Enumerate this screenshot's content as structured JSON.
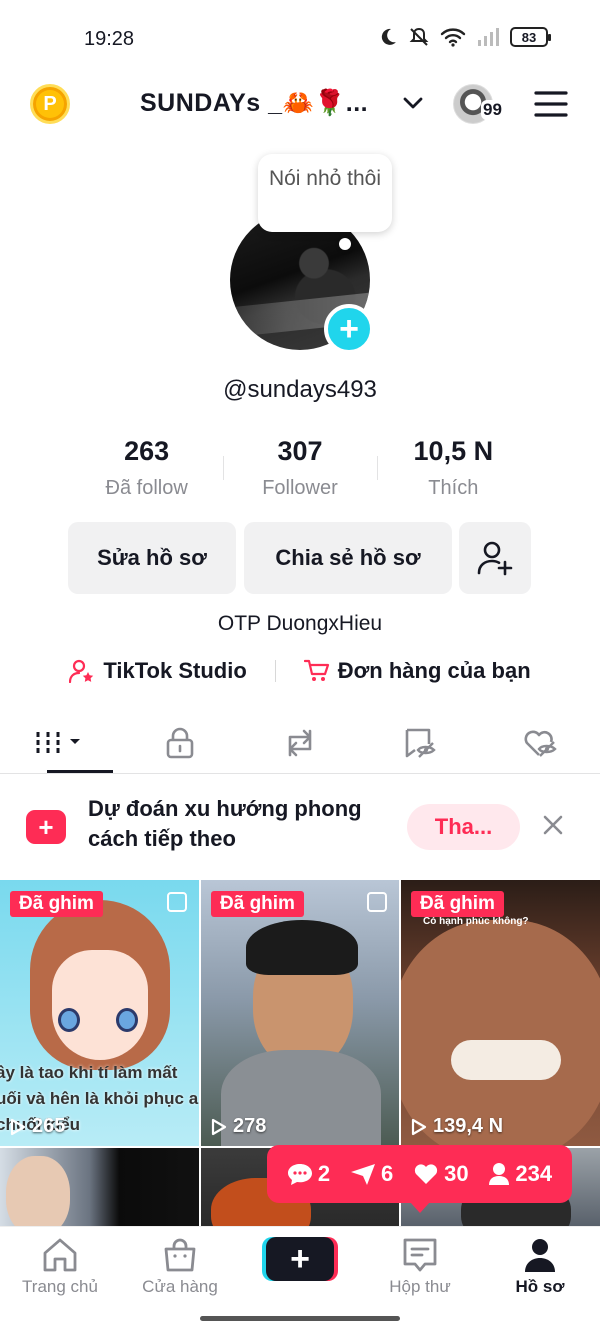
{
  "status_bar": {
    "time": "19:28",
    "battery": "83"
  },
  "header": {
    "coin": "P",
    "title": "SUNDAYs _🦀🌹...",
    "notif_count": "99"
  },
  "profile": {
    "note": "Nói nhỏ thôi",
    "add_symbol": "+",
    "handle": "@sundays493",
    "stats": [
      {
        "value": "263",
        "label": "Đã follow"
      },
      {
        "value": "307",
        "label": "Follower"
      },
      {
        "value": "10,5 N",
        "label": "Thích"
      }
    ],
    "edit_label": "Sửa hồ sơ",
    "share_label": "Chia sẻ hồ sơ",
    "bio": "OTP DuongxHieu",
    "studio_label": "TikTok Studio",
    "orders_label": "Đơn hàng của bạn"
  },
  "tabs": [
    "videos",
    "private",
    "reposts",
    "hidden",
    "liked"
  ],
  "promo": {
    "icon_symbol": "+",
    "text": "Dự đoán xu hướng phong cách tiếp theo",
    "button": "Tha..."
  },
  "videos": [
    {
      "pinned": "Đã ghim",
      "views": "265",
      "caption": "ây là tao khi tí làm mất uối và hên là khỏi phục a chuối kiểu"
    },
    {
      "pinned": "Đã ghim",
      "views": "278"
    },
    {
      "pinned": "Đã ghim",
      "views": "139,4 N",
      "caption": "Có hạnh phúc không?"
    }
  ],
  "video_stats": {
    "comments": "2",
    "shares": "6",
    "likes": "30",
    "followers": "234"
  },
  "nav": {
    "home": "Trang chủ",
    "shop": "Cửa hàng",
    "create": "+",
    "inbox": "Hộp thư",
    "profile": "Hồ sơ"
  },
  "colors": {
    "accent": "#fe2c55",
    "cyan": "#20d5ec",
    "text": "#161823",
    "muted": "#8a8b91"
  }
}
